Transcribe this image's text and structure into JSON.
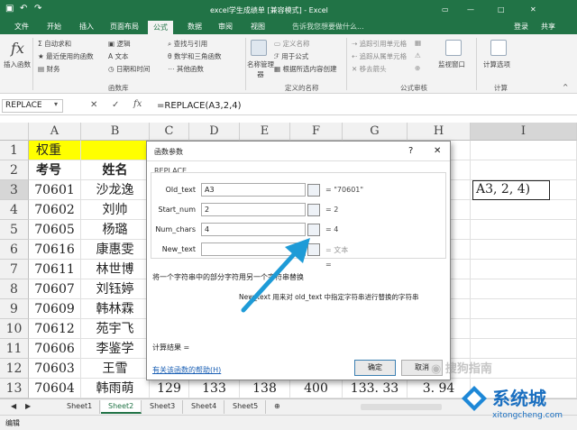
{
  "titlebar": {
    "title": "excel学生成绩单 [兼容模式] - Excel",
    "login": "登录",
    "share": "共享",
    "restore_icon": "ribbon-display-icon",
    "min": "—",
    "max": "□",
    "close": "✕"
  },
  "tabs": [
    "文件",
    "开始",
    "插入",
    "页面布局",
    "公式",
    "数据",
    "审阅",
    "视图",
    "告诉我您想要做什么..."
  ],
  "ribbon": {
    "insert_fn": "插入函数",
    "autosum": "自动求和",
    "recent": "最近使用的函数",
    "financial": "财务",
    "logical": "逻辑",
    "text": "文本",
    "datetime": "日期和时间",
    "lookup": "查找与引用",
    "math": "数学和三角函数",
    "other": "其他函数",
    "lib_group": "函数库",
    "name_mgr": "名称管理器",
    "define_name": "定义名称",
    "use_formula": "用于公式",
    "create_sel": "根据所选内容创建",
    "names_group": "定义的名称",
    "trace_prec": "追踪引用单元格",
    "trace_dep": "追踪从属单元格",
    "remove_arrows": "移去箭头",
    "audit_group": "公式审核",
    "watch": "监视窗口",
    "calc_options": "计算选项",
    "calc_group": "计算"
  },
  "formula": {
    "namebox": "REPLACE",
    "cancel": "✕",
    "enter": "✓",
    "fx": "fx",
    "content": "=REPLACE(A3,2,4)"
  },
  "columns": [
    "A",
    "B",
    "C",
    "D",
    "E",
    "F",
    "G",
    "H",
    "I"
  ],
  "rows": [
    {
      "num": "1",
      "a": "权重",
      "b": "",
      "c": "",
      "d": "",
      "e": "",
      "f": "",
      "g": "",
      "h": "分"
    },
    {
      "num": "2",
      "a": "考号",
      "b": "姓名",
      "c": "",
      "d": "",
      "e": "",
      "f": "",
      "g": "",
      "h": "绝"
    },
    {
      "num": "3",
      "a": "70601",
      "b": "沙龙逸",
      "c": "",
      "d": "",
      "e": "",
      "f": "",
      "g": "",
      "h": ""
    },
    {
      "num": "4",
      "a": "70602",
      "b": "刘帅",
      "c": "",
      "d": "",
      "e": "",
      "f": "",
      "g": "",
      "h": ""
    },
    {
      "num": "5",
      "a": "70605",
      "b": "杨璐",
      "c": "",
      "d": "",
      "e": "",
      "f": "",
      "g": "",
      "h": ""
    },
    {
      "num": "6",
      "a": "70616",
      "b": "康惠雯",
      "c": "",
      "d": "",
      "e": "",
      "f": "",
      "g": "",
      "h": ""
    },
    {
      "num": "7",
      "a": "70611",
      "b": "林世博",
      "c": "",
      "d": "",
      "e": "",
      "f": "",
      "g": "",
      "h": ""
    },
    {
      "num": "8",
      "a": "70607",
      "b": "刘钰婷",
      "c": "",
      "d": "",
      "e": "",
      "f": "",
      "g": "",
      "h": ""
    },
    {
      "num": "9",
      "a": "70609",
      "b": "韩林霖",
      "c": "",
      "d": "",
      "e": "",
      "f": "",
      "g": "",
      "h": ""
    },
    {
      "num": "10",
      "a": "70612",
      "b": "苑宇飞",
      "c": "",
      "d": "",
      "e": "",
      "f": "",
      "g": "",
      "h": ""
    },
    {
      "num": "11",
      "a": "70606",
      "b": "李鉴学",
      "c": "",
      "d": "",
      "e": "",
      "f": "",
      "g": "",
      "h": ""
    },
    {
      "num": "12",
      "a": "70603",
      "b": "王雪",
      "c": "",
      "d": "",
      "e": "",
      "f": "",
      "g": "",
      "h": ""
    },
    {
      "num": "13",
      "a": "70604",
      "b": "韩雨萌",
      "c": "129",
      "d": "133",
      "e": "138",
      "f": "400",
      "g": "133. 33",
      "h": "3. 94"
    }
  ],
  "cell_i3": "A3, 2, 4)",
  "dialog": {
    "title": "函数参数",
    "help": "?",
    "close": "✕",
    "fn_name": "REPLACE",
    "args": [
      {
        "label": "Old_text",
        "value": "A3",
        "result": "= \"70601\""
      },
      {
        "label": "Start_num",
        "value": "2",
        "result": "= 2"
      },
      {
        "label": "Num_chars",
        "value": "4",
        "result": "= 4"
      },
      {
        "label": "New_text",
        "value": "",
        "result": "= 文本"
      }
    ],
    "eq": "=",
    "desc": "将一个字符串中的部分字符用另一个字符串替换",
    "arg_help": "New_text  用来对 old_text 中指定字符串进行替换的字符串",
    "calc_result": "计算结果 =",
    "help_link": "有关该函数的帮助(H)",
    "ok": "确定",
    "cancel": "取消"
  },
  "sheets": [
    "Sheet1",
    "Sheet2",
    "Sheet3",
    "Sheet4",
    "Sheet5"
  ],
  "active_sheet": 1,
  "status": "编辑",
  "watermark": {
    "text": "搜狗指南"
  },
  "logo": {
    "brand": "系统城",
    "url": "xitongcheng.com"
  },
  "colors": {
    "excel_green": "#217346",
    "arrow": "#1e9bd7",
    "yellow": "#ffff00"
  }
}
